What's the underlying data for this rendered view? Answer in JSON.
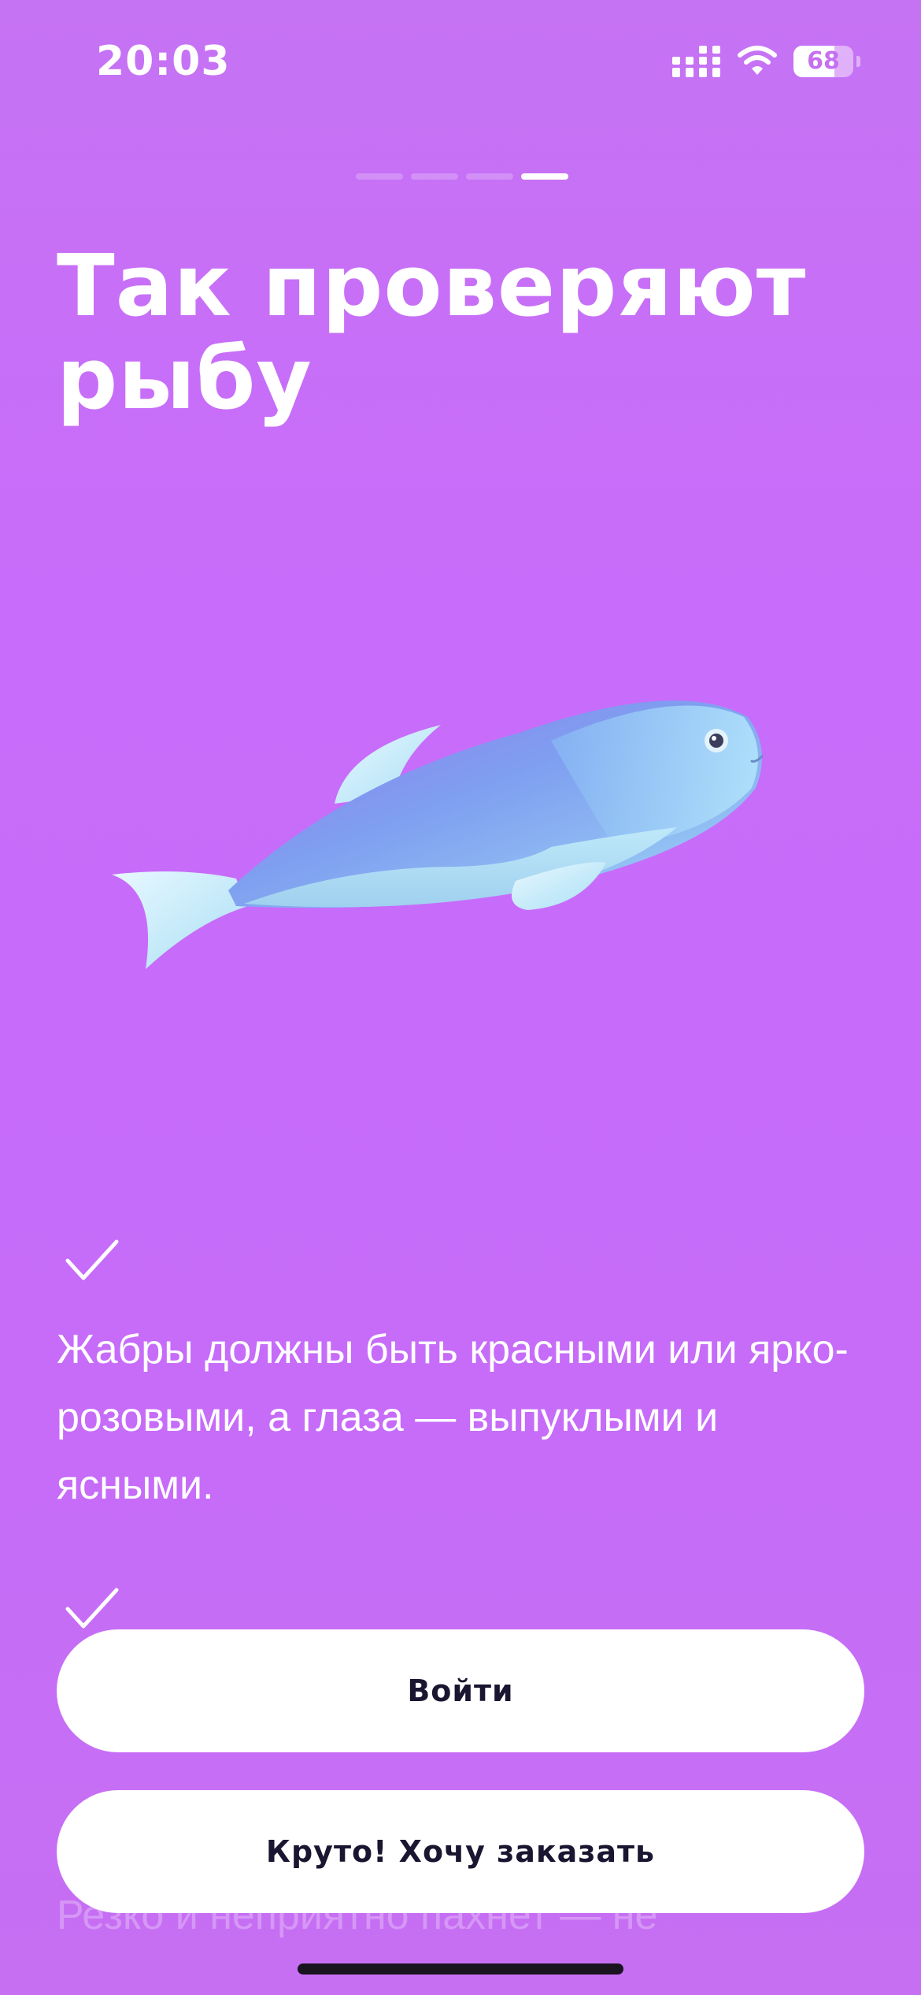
{
  "status_bar": {
    "time": "20:03",
    "battery_level": "68",
    "battery_fraction": 0.68
  },
  "onboarding": {
    "progress": {
      "total_steps": 4,
      "current_step": 4
    },
    "title": "Так проверяют рыбу",
    "illustration": "fish-illustration",
    "facts": [
      {
        "icon": "check-icon",
        "text": "Жабры должны быть красными или ярко-розовыми, а глаза — выпуклыми и ясными."
      },
      {
        "icon": "check-icon",
        "text": "Резко и неприятно пахнет — не"
      }
    ]
  },
  "actions": {
    "login_label": "Войти",
    "order_label": "Круто! Хочу заказать"
  },
  "colors": {
    "background": "#c86cfb",
    "button_bg": "#ffffff",
    "button_text": "#1a1530"
  }
}
